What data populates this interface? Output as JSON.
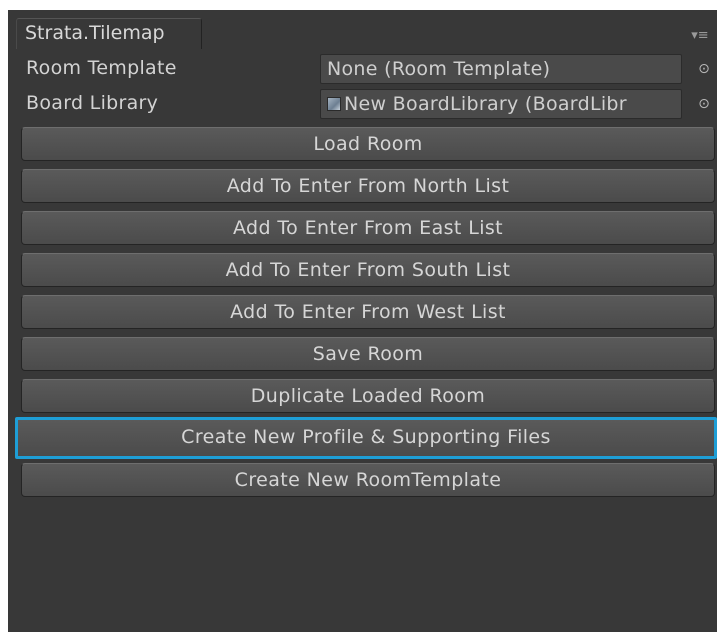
{
  "window": {
    "tab_title": "Strata.Tilemap",
    "tab_menu_glyph": "▾≡"
  },
  "properties": [
    {
      "label": "Room Template",
      "value": "None (Room Template)",
      "has_icon": false,
      "picker_icon": "object-picker-icon"
    },
    {
      "label": "Board Library",
      "value": "New BoardLibrary (BoardLibr",
      "has_icon": true,
      "picker_icon": "object-picker-icon"
    }
  ],
  "buttons": [
    {
      "label": "Load Room"
    },
    {
      "label": "Add To Enter From North List"
    },
    {
      "label": "Add To Enter From East List"
    },
    {
      "label": "Add To Enter From South List"
    },
    {
      "label": "Add To Enter From West List"
    },
    {
      "label": "Save Room"
    },
    {
      "label": "Duplicate Loaded Room"
    },
    {
      "label": "Create New Profile & Supporting Files",
      "focused": true
    },
    {
      "label": "Create New RoomTemplate"
    }
  ],
  "colors": {
    "panel_bg": "#383838",
    "focus_outline": "#1e9ed6",
    "button_bg": "#505050",
    "text": "#d6d6d6"
  }
}
